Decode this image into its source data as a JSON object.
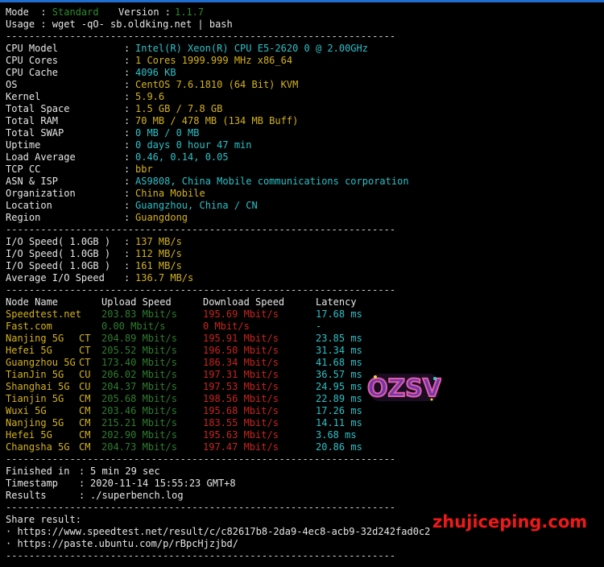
{
  "header": {
    "mode_label": "Mode  : ",
    "mode_value": "Standard",
    "version_label": "Version : ",
    "version_value": "1.1.7",
    "usage": "Usage : wget -qO- sb.oldking.net | bash"
  },
  "separator": "-------------------------------------------------------------------",
  "system": [
    {
      "label": "CPU Model",
      "value": "Intel(R) Xeon(R) CPU E5-2620 0 @ 2.00GHz",
      "color": "cyan"
    },
    {
      "label": "CPU Cores",
      "value": "1 Cores 1999.999 MHz x86_64",
      "color": "yellow"
    },
    {
      "label": "CPU Cache",
      "value": "4096 KB",
      "color": "cyan"
    },
    {
      "label": "OS",
      "value": "CentOS 7.6.1810 (64 Bit) KVM",
      "color": "yellow"
    },
    {
      "label": "Kernel",
      "value": "5.9.6",
      "color": "yellow"
    },
    {
      "label": "Total Space",
      "value": "1.5 GB / 7.8 GB",
      "color": "yellow"
    },
    {
      "label": "Total RAM",
      "value": "70 MB / 478 MB (134 MB Buff)",
      "color": "yellow"
    },
    {
      "label": "Total SWAP",
      "value": "0 MB / 0 MB",
      "color": "cyan"
    },
    {
      "label": "Uptime",
      "value": "0 days 0 hour 47 min",
      "color": "cyan"
    },
    {
      "label": "Load Average",
      "value": "0.46, 0.14, 0.05",
      "color": "cyan"
    },
    {
      "label": "TCP CC",
      "value": "bbr",
      "color": "yellow"
    },
    {
      "label": "ASN & ISP",
      "value": "AS9808, China Mobile communications corporation",
      "color": "cyan"
    },
    {
      "label": "Organization",
      "value": "China Mobile",
      "color": "yellow"
    },
    {
      "label": "Location",
      "value": "Guangzhou, China / CN",
      "color": "cyan"
    },
    {
      "label": "Region",
      "value": "Guangdong",
      "color": "yellow"
    }
  ],
  "io": [
    {
      "label": "I/O Speed( 1.0GB )",
      "value": "137 MB/s"
    },
    {
      "label": "I/O Speed( 1.0GB )",
      "value": "112 MB/s"
    },
    {
      "label": "I/O Speed( 1.0GB )",
      "value": "161 MB/s"
    },
    {
      "label": "Average I/O Speed",
      "value": "136.7 MB/s"
    }
  ],
  "speed": {
    "headers": [
      "Node Name",
      "Upload Speed",
      "Download Speed",
      "Latency"
    ],
    "rows": [
      {
        "node": "Speedtest.net",
        "isp": "",
        "up": "203.83 Mbit/s",
        "down": "195.69 Mbit/s",
        "lat": "17.68 ms"
      },
      {
        "node": "Fast.com",
        "isp": "",
        "up": "0.00 Mbit/s",
        "down": "0 Mbit/s",
        "lat": "-"
      },
      {
        "node": "Nanjing 5G",
        "isp": "CT",
        "up": "204.89 Mbit/s",
        "down": "195.91 Mbit/s",
        "lat": "23.85 ms"
      },
      {
        "node": "Hefei 5G",
        "isp": "CT",
        "up": "205.52 Mbit/s",
        "down": "196.50 Mbit/s",
        "lat": "31.34 ms"
      },
      {
        "node": "Guangzhou 5G",
        "isp": "CT",
        "up": "173.40 Mbit/s",
        "down": "186.34 Mbit/s",
        "lat": "41.68 ms"
      },
      {
        "node": "TianJin 5G",
        "isp": "CU",
        "up": "206.02 Mbit/s",
        "down": "197.31 Mbit/s",
        "lat": "36.57 ms"
      },
      {
        "node": "Shanghai 5G",
        "isp": "CU",
        "up": "204.37 Mbit/s",
        "down": "197.53 Mbit/s",
        "lat": "24.95 ms"
      },
      {
        "node": "Tianjin 5G",
        "isp": "CM",
        "up": "205.68 Mbit/s",
        "down": "198.56 Mbit/s",
        "lat": "22.89 ms"
      },
      {
        "node": "Wuxi 5G",
        "isp": "CM",
        "up": "203.46 Mbit/s",
        "down": "195.68 Mbit/s",
        "lat": "17.26 ms"
      },
      {
        "node": "Nanjing 5G",
        "isp": "CM",
        "up": "215.21 Mbit/s",
        "down": "183.55 Mbit/s",
        "lat": "14.11 ms"
      },
      {
        "node": "Hefei 5G",
        "isp": "CM",
        "up": "202.90 Mbit/s",
        "down": "195.63 Mbit/s",
        "lat": "3.68 ms"
      },
      {
        "node": "Changsha 5G",
        "isp": "CM",
        "up": "204.73 Mbit/s",
        "down": "197.47 Mbit/s",
        "lat": "20.86 ms"
      }
    ]
  },
  "finish": [
    {
      "label": "Finished in",
      "value": "5 min 29 sec"
    },
    {
      "label": "Timestamp",
      "value": "2020-11-14 15:55:23 GMT+8"
    },
    {
      "label": "Results",
      "value": "./superbench.log"
    }
  ],
  "share": {
    "title": "Share result:",
    "links": [
      "· https://www.speedtest.net/result/c/c82617b8-2da9-4ec8-acb9-32d242fad0c2",
      "· https://paste.ubuntu.com/p/rBpcHjzjbd/"
    ]
  },
  "logo_text": "OZSV",
  "watermark": "zhujiceping.com",
  "colors": {
    "background": "#000000",
    "topbar": "#1f6fd1",
    "cyan": "#2bc0c7",
    "yellow": "#d4b21c",
    "green": "#2e8b2e",
    "red": "#c8241c",
    "watermark": "#f01818"
  }
}
